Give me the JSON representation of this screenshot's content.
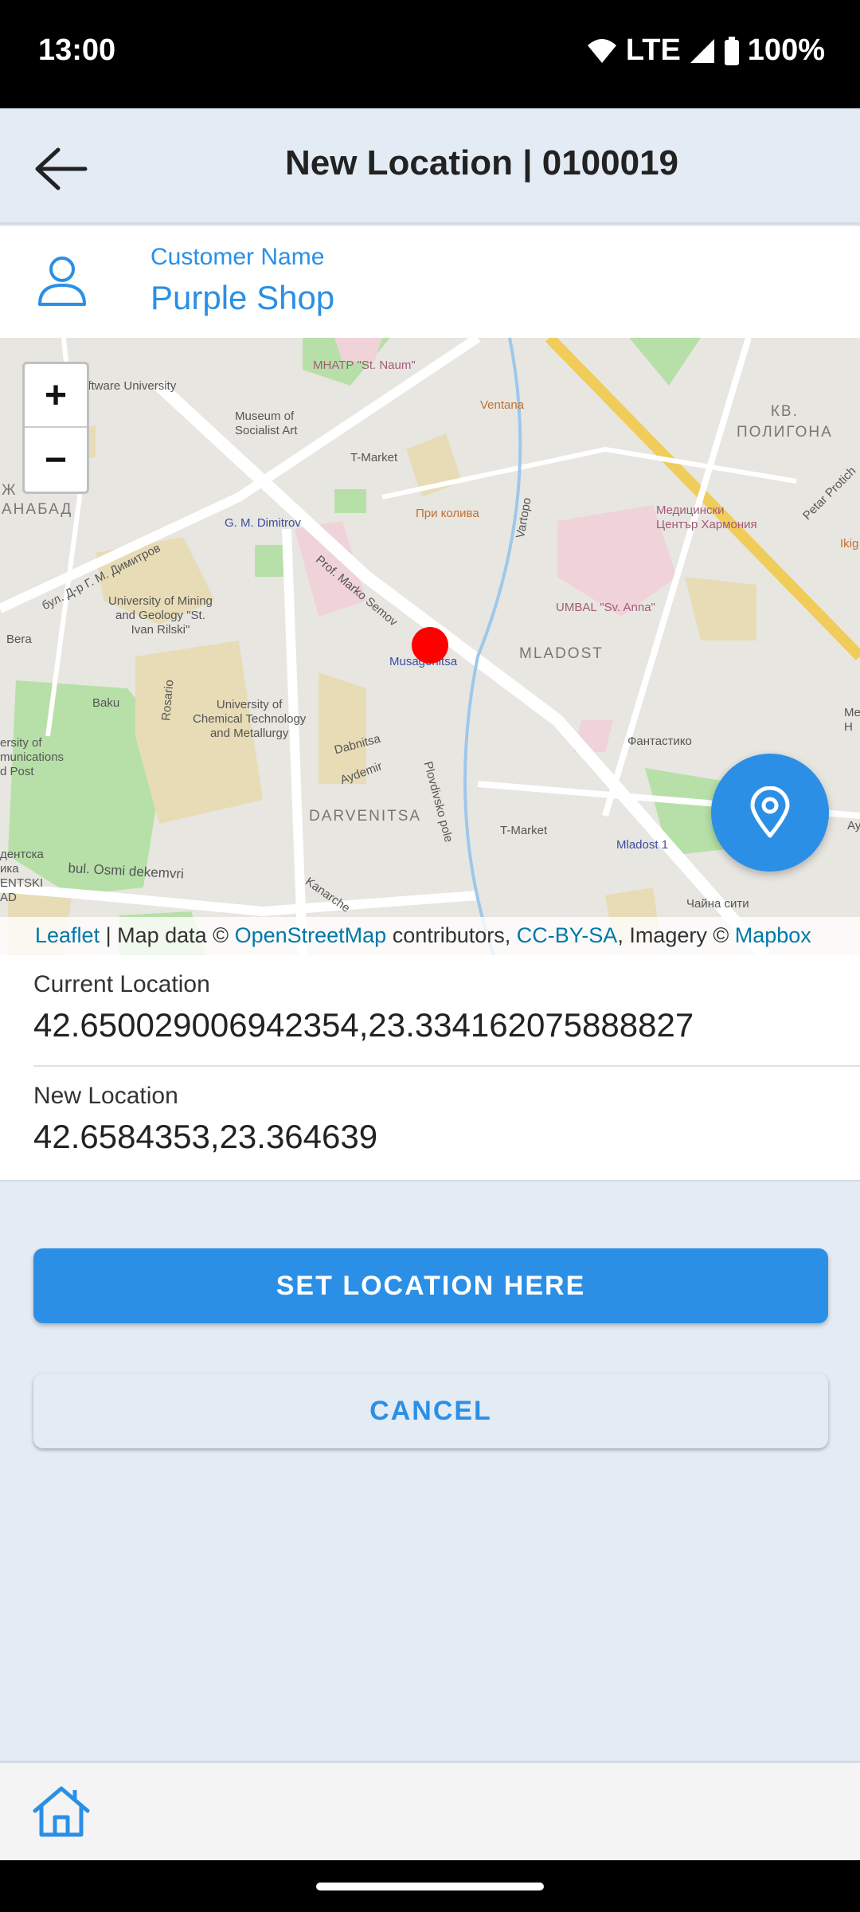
{
  "status_bar": {
    "time": "13:00",
    "network": "LTE",
    "battery": "100%"
  },
  "app_bar": {
    "title": "New Location | 0100019",
    "back_icon": "arrow-left-icon"
  },
  "customer": {
    "label": "Customer Name",
    "name": "Purple Shop",
    "icon": "person-icon"
  },
  "map": {
    "zoom_in": "+",
    "zoom_out": "−",
    "labels": {
      "mhatr": "МНАТР \"St. Naum\"",
      "software_univ": "oftware University",
      "museum": "Museum of\nSocialist Art",
      "ventana": "Ventana",
      "tmarket1": "T-Market",
      "kv_poligona": "КВ.\nПОЛИГОНА",
      "med_center": "Медицински\nЦентър Хармония",
      "petar_protich": "Petar Protich",
      "zh_anabad": "Ж\nАНАБАД",
      "gm_dimitrov": "G. M. Dimitrov",
      "pri_kolyva": "При колива",
      "vartopo": "Vartopo",
      "bul_dimitrov": "бул. Д-р Г. М. Димитров",
      "prof_marko": "Prof. Marko Semov",
      "univ_mining": "University of Mining\nand Geology \"St.\nIvan Rilski\"",
      "umbal": "UMBAL \"Sv. Anna\"",
      "ikig": "Ikig",
      "bera": "Bera",
      "musagenitsa": "Musagenitsa",
      "mladost": "MLADOST",
      "baku": "Baku",
      "rosario": "Rosario",
      "univ_chem": "University of\nChemical Technology\nand Metallurgy",
      "fantastiko": "Фантастико",
      "dabnitsa": "Dabnitsa",
      "aydemir": "Aydemir",
      "plovdivsko": "Plovdivsko pole",
      "darvenitsa": "DARVENITSA",
      "tmarket2": "T-Market",
      "mladost1": "Mladost 1",
      "univ_comm": "ersity of\nmunications\nd Post",
      "osmi": "bul. Osmi dekemvri",
      "kanarche": "Kanarche",
      "chaina": "Чайна сити",
      "entski": "дентска\nика\nENTSKI\nAD",
      "me": "Me\nH",
      "ay": "Ay"
    },
    "attribution": {
      "leaflet": "Leaflet",
      "sep": " | Map data © ",
      "osm": "OpenStreetMap",
      "contrib": " contributors, ",
      "license": "CC-BY-SA",
      "imagery": ", Imagery © ",
      "mapbox": "Mapbox"
    },
    "marker_color": "#ff0000",
    "fab_icon": "map-pin-icon"
  },
  "locations": {
    "current_label": "Current Location",
    "current_value": "42.650029006942354,23.334162075888827",
    "new_label": "New Location",
    "new_value": "42.6584353,23.364639"
  },
  "actions": {
    "set_location": "SET LOCATION HERE",
    "cancel": "CANCEL"
  },
  "bottom_nav": {
    "home_icon": "home-icon"
  },
  "colors": {
    "accent": "#2b8fe6",
    "background": "#e3ebf4"
  }
}
